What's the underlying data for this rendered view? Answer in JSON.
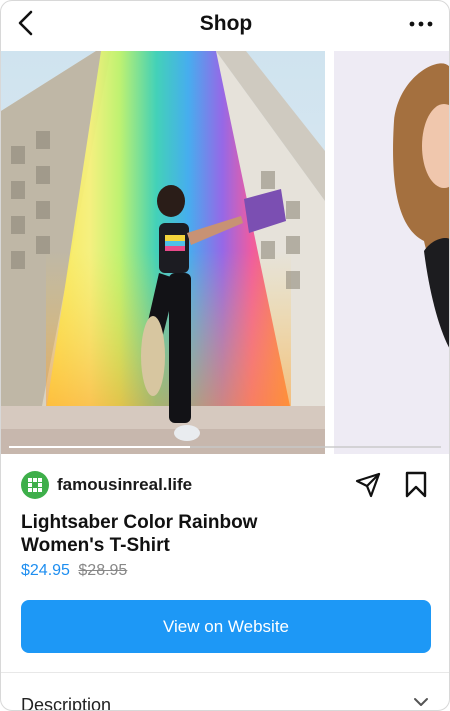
{
  "header": {
    "title": "Shop",
    "back_icon": "chevron-left-icon",
    "more_icon": "more-horizontal-icon"
  },
  "carousel": {
    "images": [
      {
        "name": "product-photo-rainbow-mural"
      },
      {
        "name": "product-photo-model-closeup"
      }
    ],
    "progress": 0.42
  },
  "seller": {
    "name": "famousinreal.life",
    "avatar_color": "#3eaf4a"
  },
  "actions": {
    "share_icon": "send-icon",
    "save_icon": "bookmark-icon"
  },
  "product": {
    "name_line1": "Lightsaber Color Rainbow",
    "name_line2": "Women's T-Shirt",
    "sale_price": "$24.95",
    "original_price": "$28.95"
  },
  "cta": {
    "label": "View on Website",
    "color": "#1d98f6"
  },
  "description": {
    "label": "Description"
  },
  "colors": {
    "price_accent": "#1e8ef0"
  }
}
